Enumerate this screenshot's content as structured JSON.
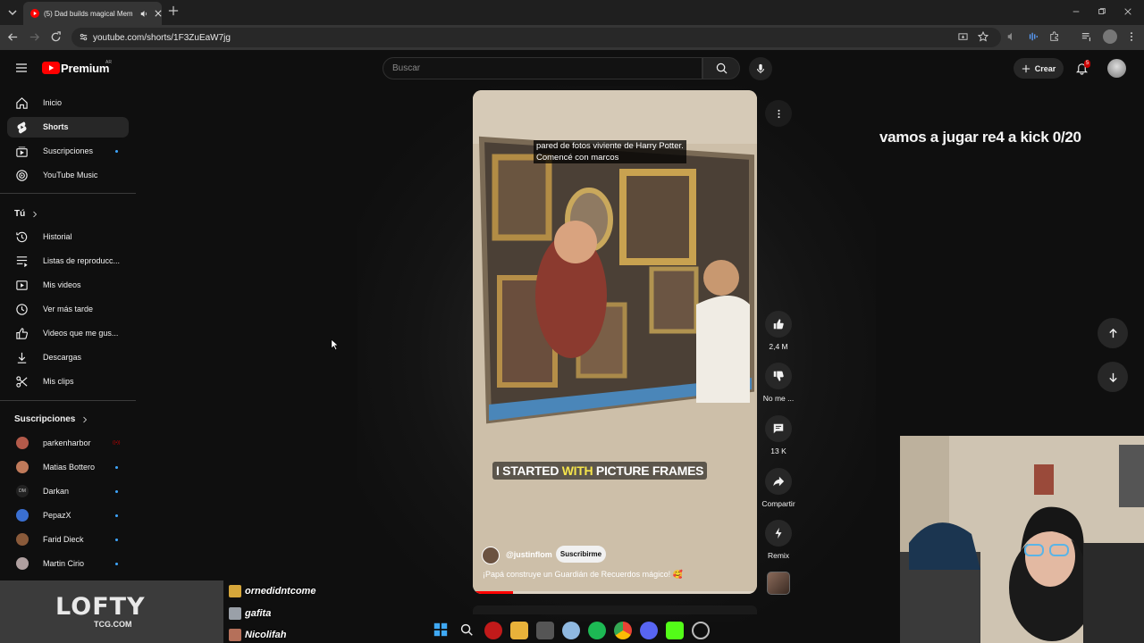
{
  "browser": {
    "tab_title": "(5) Dad builds magical Mem",
    "url": "youtube.com/shorts/1F3ZuEaW7jg"
  },
  "header": {
    "logo_text": "Premium",
    "country": "AR",
    "search_placeholder": "Buscar",
    "create_label": "Crear",
    "notification_count": "5"
  },
  "sidebar": {
    "main": [
      {
        "label": "Inicio",
        "icon": "home-icon"
      },
      {
        "label": "Shorts",
        "icon": "shorts-icon",
        "active": true
      },
      {
        "label": "Suscripciones",
        "icon": "subscriptions-icon"
      },
      {
        "label": "YouTube Music",
        "icon": "music-icon"
      }
    ],
    "you_heading": "Tú",
    "you": [
      {
        "label": "Historial",
        "icon": "history-icon"
      },
      {
        "label": "Listas de reproducc...",
        "icon": "playlist-icon"
      },
      {
        "label": "Mis videos",
        "icon": "my-videos-icon"
      },
      {
        "label": "Ver más tarde",
        "icon": "watch-later-icon"
      },
      {
        "label": "Videos que me gus...",
        "icon": "liked-icon"
      },
      {
        "label": "Descargas",
        "icon": "download-icon"
      },
      {
        "label": "Mis clips",
        "icon": "clips-icon"
      }
    ],
    "subs_heading": "Suscripciones",
    "subs": [
      {
        "label": "parkenharbor",
        "color": "#b35a4a",
        "live": true
      },
      {
        "label": "Matias Bottero",
        "color": "#c07a5a"
      },
      {
        "label": "Darkan",
        "color": "#222222",
        "text": "DM"
      },
      {
        "label": "PepazX",
        "color": "#3a6fd1"
      },
      {
        "label": "Farid Dieck",
        "color": "#8a5a3a"
      },
      {
        "label": "Martin Cirio",
        "color": "#b0a0a0"
      }
    ]
  },
  "video": {
    "caption_top_1": "pared de fotos viviente de Harry Potter.",
    "caption_top_2": "Comencé con marcos",
    "caption_bottom_a": "I STARTED ",
    "caption_bottom_b": "WITH",
    "caption_bottom_c": " PICTURE FRAMES",
    "channel": "@justinflom",
    "subscribe": "Suscribirme",
    "description": "¡Papá construye un Guardián de Recuerdos mágico! 🥰",
    "progress": 0.14
  },
  "actions": {
    "likes": "2,4 M",
    "dislike": "No me ...",
    "comments": "13 K",
    "share": "Compartir",
    "remix": "Remix"
  },
  "overlay": {
    "goal": "vamos a jugar re4 a kick  0/20",
    "sponsor": "LOFTY",
    "sponsor_sub": "TCG.COM",
    "gifters": [
      "ornedidntcome",
      "gafita",
      "Nicolifah"
    ]
  }
}
